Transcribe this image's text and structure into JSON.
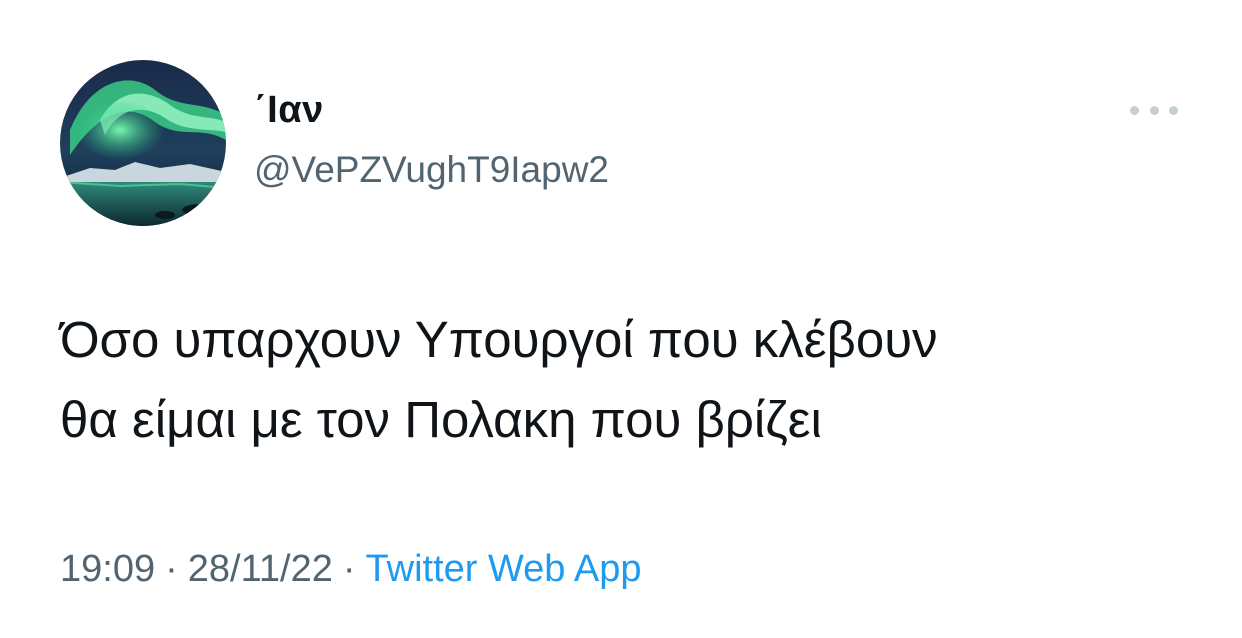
{
  "author": {
    "display_name": "΄Ιαν",
    "handle": "@VePZVughT9Iapw2",
    "avatar_icon": "aurora-avatar-icon"
  },
  "menu": {
    "icon": "more-options-icon"
  },
  "tweet": {
    "text": "Όσο υπαρχουν Υπουργοί που κλέβουν\nθα είμαι με τον Πολακη που βρίζει",
    "time": "19:09",
    "separator": "·",
    "date": "28/11/22",
    "source": "Twitter Web App"
  },
  "colors": {
    "text": "#0f1419",
    "secondary": "#536471",
    "link": "#1d9bf0",
    "menu_dots": "#c4cfd6"
  }
}
